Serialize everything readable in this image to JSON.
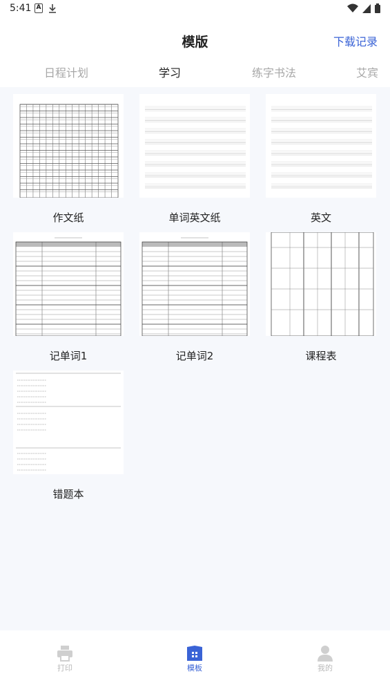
{
  "status_bar": {
    "time": "5:41"
  },
  "header": {
    "title": "模版",
    "download_records": "下载记录"
  },
  "tabs": [
    {
      "label": "日程计划",
      "active": false
    },
    {
      "label": "学习",
      "active": true
    },
    {
      "label": "练字书法",
      "active": false
    },
    {
      "label": "艾宾",
      "active": false
    }
  ],
  "templates": [
    {
      "label": "作文纸",
      "preview": "grid-paper"
    },
    {
      "label": "单词英文纸",
      "preview": "english-lines"
    },
    {
      "label": "英文",
      "preview": "english-lines"
    },
    {
      "label": "记单词1",
      "preview": "vocab-table"
    },
    {
      "label": "记单词2",
      "preview": "vocab-table"
    },
    {
      "label": "课程表",
      "preview": "timetable"
    },
    {
      "label": "错题本",
      "preview": "mistake-notebook"
    }
  ],
  "bottom_nav": [
    {
      "label": "打印",
      "icon": "printer-icon",
      "active": false
    },
    {
      "label": "模板",
      "icon": "template-icon",
      "active": true
    },
    {
      "label": "我的",
      "icon": "user-icon",
      "active": false
    }
  ],
  "colors": {
    "accent": "#3a63d6",
    "inactive": "#b9b9b9",
    "background": "#f6f8fc"
  }
}
